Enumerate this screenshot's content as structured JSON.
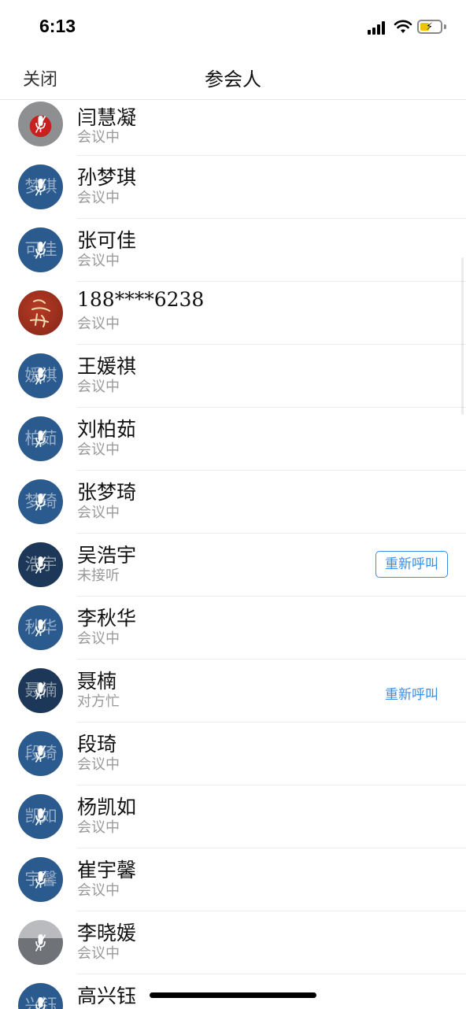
{
  "status_bar": {
    "time": "6:13",
    "signal_icon": "cellular-signal-icon",
    "wifi_icon": "wifi-icon",
    "battery_icon": "battery-charging-icon"
  },
  "nav": {
    "close_label": "关闭",
    "title": "参会人"
  },
  "colors": {
    "accent": "#3a8ee6",
    "avatar_blue": "#2b5a8e",
    "avatar_dark": "#1c3757",
    "secondary_text": "#999999"
  },
  "participants": [
    {
      "name": "闫慧凝",
      "status": "会议中",
      "avatar_text": "",
      "avatar_type": "photo-red"
    },
    {
      "name": "孙梦琪",
      "status": "会议中",
      "avatar_text": "梦琪",
      "avatar_type": "blue"
    },
    {
      "name": "张可佳",
      "status": "会议中",
      "avatar_text": "可佳",
      "avatar_type": "blue"
    },
    {
      "name": "188****6238",
      "status": "会议中",
      "avatar_text": "",
      "avatar_type": "calligraphy"
    },
    {
      "name": "王媛祺",
      "status": "会议中",
      "avatar_text": "媛祺",
      "avatar_type": "blue"
    },
    {
      "name": "刘柏茹",
      "status": "会议中",
      "avatar_text": "柏茹",
      "avatar_type": "blue"
    },
    {
      "name": "张梦琦",
      "status": "会议中",
      "avatar_text": "梦琦",
      "avatar_type": "blue"
    },
    {
      "name": "吴浩宇",
      "status": "未接听",
      "avatar_text": "浩宇",
      "avatar_type": "dark",
      "action": "重新呼叫",
      "action_style": "button"
    },
    {
      "name": "李秋华",
      "status": "会议中",
      "avatar_text": "秋华",
      "avatar_type": "blue"
    },
    {
      "name": "聂楠",
      "status": "对方忙",
      "avatar_text": "聂楠",
      "avatar_type": "dark",
      "action": "重新呼叫",
      "action_style": "link"
    },
    {
      "name": "段琦",
      "status": "会议中",
      "avatar_text": "段琦",
      "avatar_type": "blue"
    },
    {
      "name": "杨凯如",
      "status": "会议中",
      "avatar_text": "凯如",
      "avatar_type": "blue"
    },
    {
      "name": "崔宇馨",
      "status": "会议中",
      "avatar_text": "宇馨",
      "avatar_type": "blue"
    },
    {
      "name": "李晓媛",
      "status": "会议中",
      "avatar_text": "",
      "avatar_type": "photo-gray"
    },
    {
      "name": "高兴钰",
      "status": "",
      "avatar_text": "兴钰",
      "avatar_type": "blue"
    }
  ]
}
